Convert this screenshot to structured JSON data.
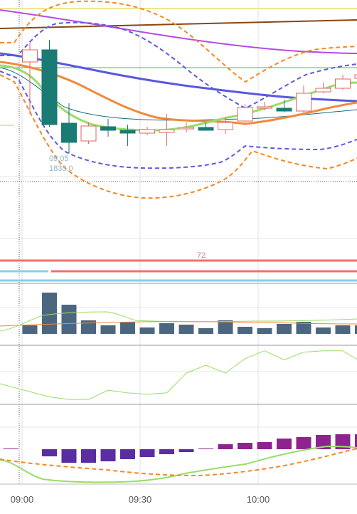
{
  "colors": {
    "up_candle": "#ffffff",
    "up_candle_border": "#e06666",
    "down_candle": "#1a7a74",
    "volume_bar": "#4d6680",
    "macd_positive": "#8e2390",
    "macd_negative": "#5a2ea0",
    "bollinger": "#5b5be0",
    "envelope": "#f08a24",
    "sma_short": "#99dd66",
    "sma_mid": "#f08a3c",
    "sma_long": "#5858e0",
    "trend_brown": "#8b4513",
    "trend_purple": "#b44ae6",
    "level_line": "#f07070",
    "level_blue": "#87ceeb",
    "grid": "#e0e0e0"
  },
  "chart_data": {
    "type": "candlestick",
    "grid": true,
    "x_ticks": [
      "09:00",
      "09:30",
      "10:00"
    ],
    "crosshair_annotation": {
      "time": "09:05",
      "value": "1833.0"
    },
    "level_label": "72",
    "candles": [
      {
        "o": 87,
        "h": 60,
        "l": 160,
        "c": 70
      },
      {
        "o": 70,
        "h": 56,
        "l": 178,
        "c": 175
      },
      {
        "o": 173,
        "h": 145,
        "l": 215,
        "c": 200
      },
      {
        "o": 198,
        "h": 172,
        "l": 202,
        "c": 177
      },
      {
        "o": 178,
        "h": 167,
        "l": 192,
        "c": 183
      },
      {
        "o": 183,
        "h": 175,
        "l": 205,
        "c": 187
      },
      {
        "o": 187,
        "h": 178,
        "l": 190,
        "c": 182
      },
      {
        "o": 186,
        "h": 160,
        "l": 205,
        "c": 182
      },
      {
        "o": 180,
        "h": 172,
        "l": 186,
        "c": 179
      },
      {
        "o": 179,
        "h": 172,
        "l": 183,
        "c": 183
      },
      {
        "o": 182,
        "h": 164,
        "l": 188,
        "c": 172
      },
      {
        "o": 170,
        "h": 146,
        "l": 172,
        "c": 151
      },
      {
        "o": 151,
        "h": 143,
        "l": 155,
        "c": 150
      },
      {
        "o": 152,
        "h": 140,
        "l": 158,
        "c": 156
      },
      {
        "o": 156,
        "h": 120,
        "l": 158,
        "c": 131
      },
      {
        "o": 129,
        "h": 116,
        "l": 131,
        "c": 124
      },
      {
        "o": 124,
        "h": 105,
        "l": 126,
        "c": 111
      },
      {
        "o": 110,
        "h": 96,
        "l": 114,
        "c": 105
      },
      {
        "o": 104,
        "h": 100,
        "l": 136,
        "c": 126
      }
    ],
    "volume": [
      12,
      58,
      41,
      19,
      12,
      17,
      9,
      15,
      13,
      8,
      19,
      10,
      8,
      14,
      17,
      9,
      12,
      12
    ],
    "macd_hist": [
      1,
      -10,
      -19,
      -19,
      -17,
      -14,
      -11,
      -7,
      -4,
      0,
      7,
      9,
      10,
      15,
      17,
      20,
      21,
      21,
      15
    ],
    "rsi": [
      73,
      63,
      61,
      61,
      68,
      66,
      65,
      66,
      81,
      87,
      81,
      92,
      98,
      91,
      97,
      98,
      98,
      89,
      83
    ],
    "labels_visible": {
      "x": [
        "09:00",
        "09:30",
        "10:00"
      ]
    }
  }
}
